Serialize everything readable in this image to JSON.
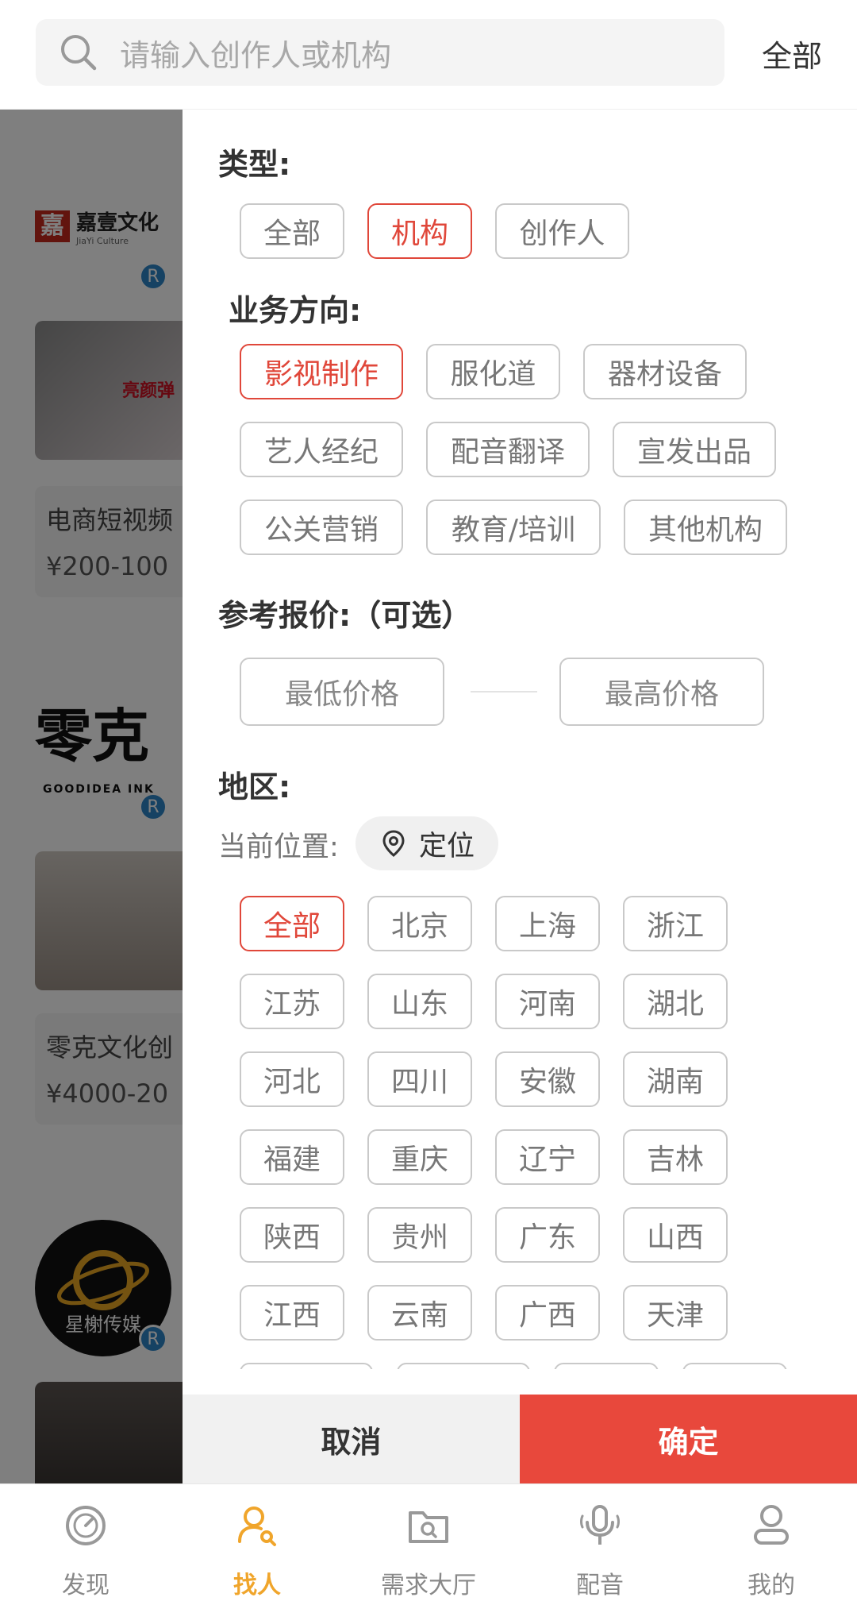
{
  "search": {
    "placeholder": "请输入创作人或机构",
    "filter_label": "全部"
  },
  "background": {
    "orgs": [
      {
        "logo_text": "嘉壹文化",
        "logo_sub": "JiaYi Culture",
        "thumb_text": "亮颜弹",
        "title": "电商短视频",
        "price": "¥200-100"
      },
      {
        "logo_text": "零克",
        "logo_sub": "GOODIDEA INK",
        "title": "零克文化创",
        "price": "¥4000-20"
      },
      {
        "logo_text": "星榭传媒"
      }
    ],
    "badge": "R"
  },
  "filter": {
    "type": {
      "title": "类型:",
      "options": [
        "全部",
        "机构",
        "创作人"
      ],
      "selected": "机构"
    },
    "business": {
      "title": "业务方向:",
      "options": [
        "影视制作",
        "服化道",
        "器材设备",
        "艺人经纪",
        "配音翻译",
        "宣发出品",
        "公关营销",
        "教育/培训",
        "其他机构"
      ],
      "selected": "影视制作"
    },
    "price": {
      "title": "参考报价:（可选）",
      "min_placeholder": "最低价格",
      "max_placeholder": "最高价格"
    },
    "region": {
      "title": "地区:",
      "current_label": "当前位置:",
      "locate_label": "定位",
      "options": [
        "全部",
        "北京",
        "上海",
        "浙江",
        "江苏",
        "山东",
        "河南",
        "湖北",
        "河北",
        "四川",
        "安徽",
        "湖南",
        "福建",
        "重庆",
        "辽宁",
        "吉林",
        "陕西",
        "贵州",
        "广东",
        "山西",
        "江西",
        "云南",
        "广西",
        "天津"
      ],
      "selected": "全部"
    },
    "cancel_label": "取消",
    "confirm_label": "确定"
  },
  "tabs": [
    {
      "label": "发现",
      "icon": "compass-icon"
    },
    {
      "label": "找人",
      "icon": "find-person-icon",
      "active": true
    },
    {
      "label": "需求大厅",
      "icon": "folder-search-icon"
    },
    {
      "label": "配音",
      "icon": "microphone-icon"
    },
    {
      "label": "我的",
      "icon": "user-icon"
    }
  ],
  "colors": {
    "accent": "#e8483c",
    "tab_active": "#f0a52b",
    "badge": "#2d85c6"
  }
}
